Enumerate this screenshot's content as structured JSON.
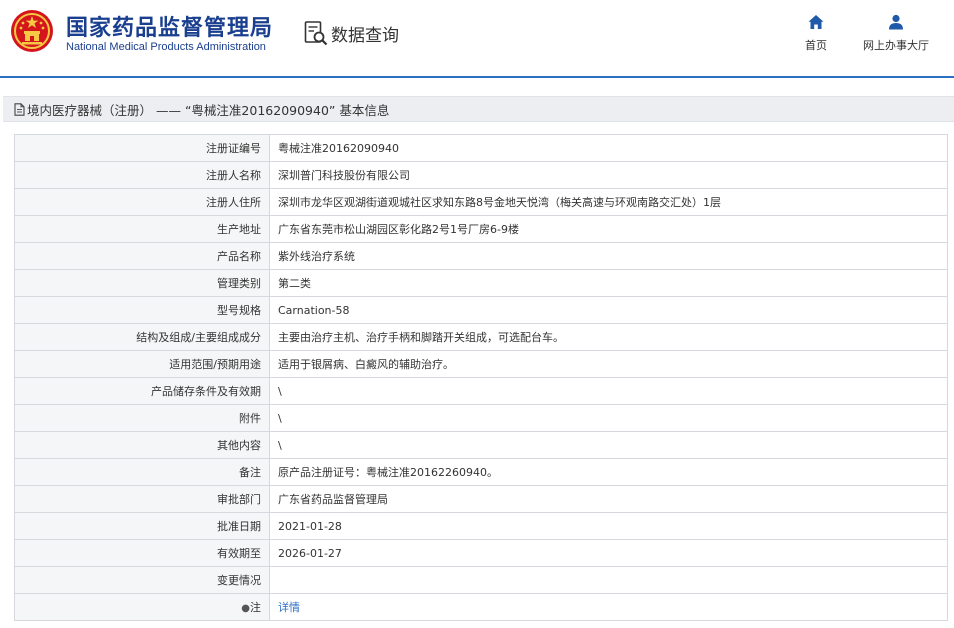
{
  "header": {
    "brand_cn": "国家药品监督管理局",
    "brand_en": "National Medical Products Administration",
    "query_label": "数据查询",
    "nav": [
      {
        "label": "首页",
        "icon": "home-icon"
      },
      {
        "label": "网上办事大厅",
        "icon": "user-icon"
      }
    ]
  },
  "colors": {
    "accent": "#2b6fc4",
    "brand": "#1b3f8f",
    "emblem": "#d4161c",
    "label_bg": "#f5f6f7"
  },
  "title": "境内医疗器械（注册） —— “粤械注准20162090940” 基本信息",
  "rows": [
    {
      "label": "注册证编号",
      "value": "粤械注准20162090940"
    },
    {
      "label": "注册人名称",
      "value": "深圳普门科技股份有限公司"
    },
    {
      "label": "注册人住所",
      "value": "深圳市龙华区观湖街道观城社区求知东路8号金地天悦湾（梅关高速与环观南路交汇处）1层"
    },
    {
      "label": "生产地址",
      "value": "广东省东莞市松山湖园区彰化路2号1号厂房6-9楼"
    },
    {
      "label": "产品名称",
      "value": "紫外线治疗系统"
    },
    {
      "label": "管理类别",
      "value": "第二类"
    },
    {
      "label": "型号规格",
      "value": "Carnation-58"
    },
    {
      "label": "结构及组成/主要组成成分",
      "value": "主要由治疗主机、治疗手柄和脚踏开关组成，可选配台车。"
    },
    {
      "label": "适用范围/预期用途",
      "value": "适用于银屑病、白癜风的辅助治疗。"
    },
    {
      "label": "产品储存条件及有效期",
      "value": "\\"
    },
    {
      "label": "附件",
      "value": "\\"
    },
    {
      "label": "其他内容",
      "value": "\\"
    },
    {
      "label": "备注",
      "value": "原产品注册证号：粤械注准20162260940。"
    },
    {
      "label": "审批部门",
      "value": "广东省药品监督管理局"
    },
    {
      "label": "批准日期",
      "value": "2021-01-28"
    },
    {
      "label": "有效期至",
      "value": "2026-01-27"
    },
    {
      "label": "变更情况",
      "value": ""
    }
  ],
  "note_row": {
    "label": "注",
    "icon": "pin-icon",
    "link": "详情"
  }
}
